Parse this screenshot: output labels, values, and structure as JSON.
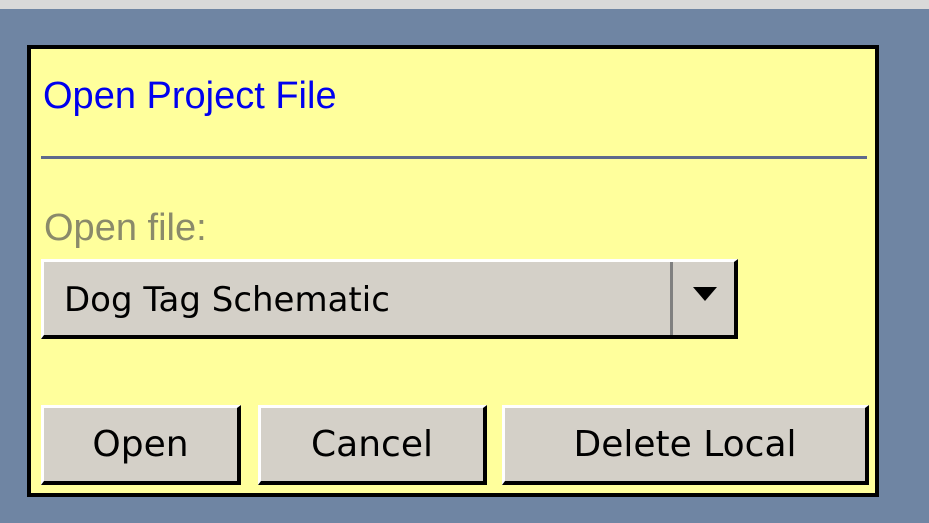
{
  "dialog": {
    "title": "Open Project File",
    "field_label": "Open file:",
    "selected_file": "Dog Tag Schematic"
  },
  "buttons": {
    "open": "Open",
    "cancel": "Cancel",
    "delete_local": "Delete Local"
  },
  "colors": {
    "background": "#6f85a3",
    "dialog": "#ffff9c",
    "title": "#0000ee",
    "label": "#8a8a6a",
    "button_face": "#d4d0c8"
  },
  "icons": {
    "dropdown": "chevron-down-icon"
  }
}
